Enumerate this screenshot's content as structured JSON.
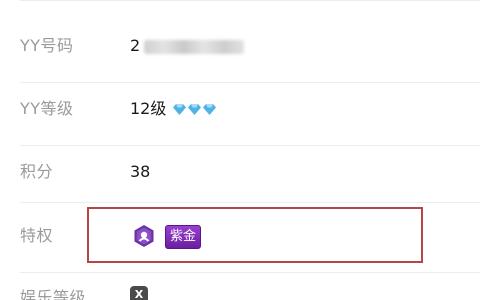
{
  "profile": {
    "rows": [
      {
        "label": "YY号码",
        "value": "2"
      },
      {
        "label": "YY等级",
        "value": "12级"
      },
      {
        "label": "积分",
        "value": "38"
      },
      {
        "label": "特权",
        "badge": "紫金"
      },
      {
        "label": "娱乐等级",
        "icon_text": "X"
      }
    ],
    "level_icon": "diamond-icon",
    "privilege_icon": "purple-privilege-icon"
  },
  "colors": {
    "label": "#9a9a9a",
    "value": "#1a1a1a",
    "highlight_border": "#b84545",
    "badge_bg": "#7a2ab5",
    "diamond": "#4fb3e8"
  }
}
